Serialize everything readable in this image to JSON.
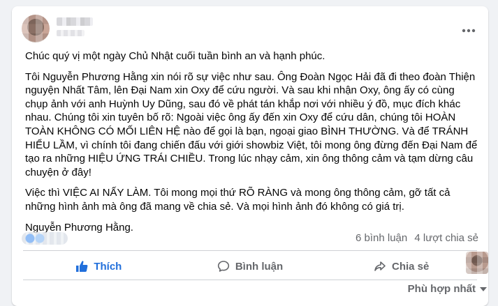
{
  "post": {
    "paragraphs": [
      "Chúc quý vị một ngày Chủ Nhật cuối tuần bình an và hạnh phúc.",
      "Tôi Nguyễn Phương Hằng xin nói rõ sự việc như sau. Ông Đoàn Ngọc Hải đã đi theo đoàn Thiện nguyện Nhất Tâm, lên Đại Nam xin Oxy để cứu người. Và sau khi nhận Oxy, ông ấy có cùng chụp ảnh với anh Huỳnh Uy Dũng, sau đó về phát tán khắp nơi với nhiều ý đồ, mục đích khác nhau. Chúng tôi xin tuyên bố rõ: Ngoài việc ông ấy đến xin Oxy để cứu dân, chúng tôi HOÀN TOÀN KHÔNG CÓ MỐI LIÊN HỆ nào để gọi là bạn, ngoại giao BÌNH THƯỜNG. Và để TRÁNH HIỂU LẦM, vì chính tôi đang chiến đấu với giới showbiz Việt, tôi mong ông đừng đến Đại Nam để tạo ra những HIỆU ỨNG TRÁI CHIỀU. Trong lúc nhạy cảm, xin ông thông cảm và tạm dừng câu chuyện ở đây!",
      "Việc thì VIỆC AI NẤY LÀM. Tôi mong mọi thứ RÕ RÀNG và mong ông thông cảm, gỡ tất cả những hình ảnh mà ông đã mang về chia sẻ. Và mọi hình ảnh đó không có giá trị.",
      "Nguyễn Phương Hằng."
    ]
  },
  "stats": {
    "comments": "6 bình luận",
    "shares": "4 lượt chia sẻ"
  },
  "actions": {
    "like": "Thích",
    "comment": "Bình luận",
    "share": "Chia sẻ"
  },
  "sort": {
    "label": "Phù hợp nhất"
  },
  "colors": {
    "like_blue": "#216fdb",
    "secondary_text": "#65676b",
    "background": "#f0f2f5"
  },
  "icons": {
    "more": "more-horizontal-icon",
    "like": "thumbs-up-icon",
    "comment": "comment-bubble-icon",
    "share": "share-arrow-icon",
    "sort": "caret-down-icon"
  }
}
